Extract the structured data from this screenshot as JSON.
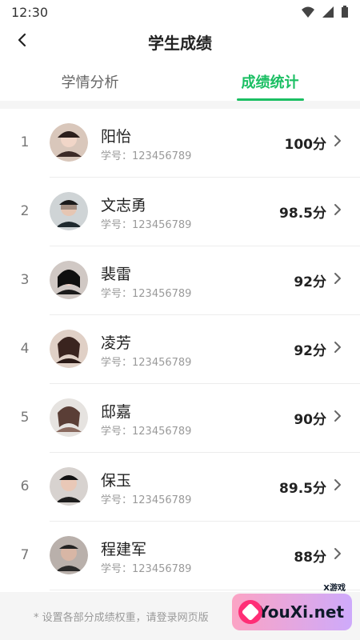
{
  "status": {
    "time": "12:30",
    "icons": [
      "wifi-icon",
      "signal-icon",
      "battery-icon"
    ]
  },
  "header": {
    "title": "学生成绩",
    "back_icon": "back-icon"
  },
  "tabs": [
    {
      "label": "学情分析",
      "active": false
    },
    {
      "label": "成绩统计",
      "active": true
    }
  ],
  "students": [
    {
      "rank": "1",
      "name": "阳怡",
      "id_label": "学号：123456789",
      "score": "100分"
    },
    {
      "rank": "2",
      "name": "文志勇",
      "id_label": "学号：123456789",
      "score": "98.5分"
    },
    {
      "rank": "3",
      "name": "裴雷",
      "id_label": "学号：123456789",
      "score": "92分"
    },
    {
      "rank": "4",
      "name": "凌芳",
      "id_label": "学号：123456789",
      "score": "92分"
    },
    {
      "rank": "5",
      "name": "邸嘉",
      "id_label": "学号：123456789",
      "score": "90分"
    },
    {
      "rank": "6",
      "name": "保玉",
      "id_label": "学号：123456789",
      "score": "89.5分"
    },
    {
      "rank": "7",
      "name": "程建军",
      "id_label": "学号：123456789",
      "score": "88分"
    }
  ],
  "footer": {
    "note": "* 设置各部分成绩权重，请登录网页版"
  },
  "watermark": {
    "small": "X游戏",
    "brand": "XYouXi.net"
  },
  "colors": {
    "accent": "#1bbf63",
    "text_primary": "#222222",
    "text_secondary": "#9a9a9a",
    "divider": "#ececec"
  }
}
